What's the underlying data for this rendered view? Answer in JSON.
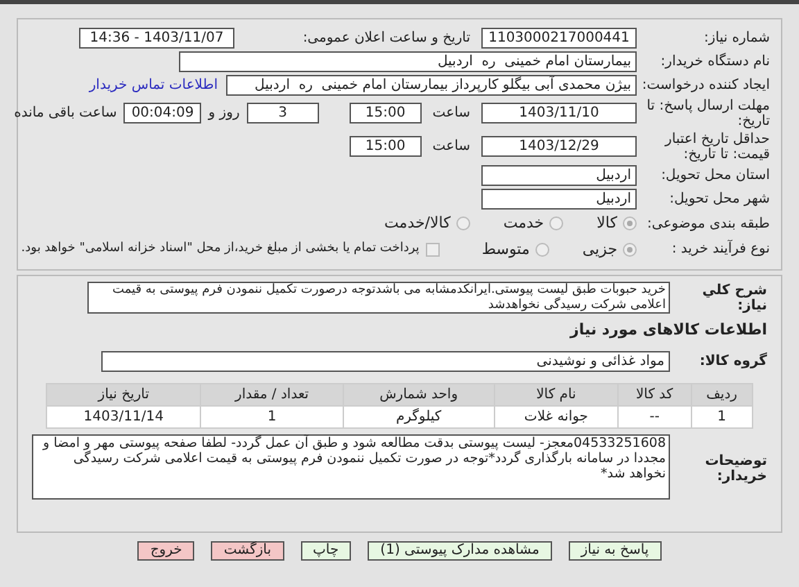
{
  "need_number": {
    "label": "شماره نیاز:",
    "value": "1103000217000441"
  },
  "announce": {
    "label": "تاریخ و ساعت اعلان عمومی:",
    "value": "1403/11/07 - 14:36"
  },
  "buyer": {
    "label": "نام دستگاه خریدار:",
    "value": "بیمارستان امام خمینی  ره  اردبیل"
  },
  "creator": {
    "label": "ایجاد کننده درخواست:",
    "value": "بیژن محمدی آبی بیگلو کارپرداز بیمارستان امام خمینی  ره  اردبیل",
    "link": "اطلاعات تماس خریدار"
  },
  "deadline": {
    "label": "مهلت ارسال پاسخ: تا تاریخ:",
    "date": "1403/11/10",
    "time_label": "ساعت",
    "time": "15:00",
    "days": "3",
    "days_label": "روز و",
    "remaining": "00:04:09",
    "remaining_label": "ساعت باقی مانده"
  },
  "validity": {
    "label": "حداقل تاریخ اعتبار قیمت: تا تاریخ:",
    "date": "1403/12/29",
    "time_label": "ساعت",
    "time": "15:00"
  },
  "province": {
    "label": "استان محل تحویل:",
    "value": "اردبیل"
  },
  "city": {
    "label": "شهر محل تحویل:",
    "value": "اردبیل"
  },
  "category": {
    "label": "طبقه بندی موضوعی:",
    "options": [
      {
        "label": "کالا",
        "selected": true
      },
      {
        "label": "خدمت",
        "selected": false
      },
      {
        "label": "کالا/خدمت",
        "selected": false
      }
    ]
  },
  "process": {
    "label": "نوع فرآیند خرید :",
    "options": [
      {
        "label": "جزیی",
        "selected": true
      },
      {
        "label": "متوسط",
        "selected": false
      }
    ],
    "treasury": {
      "label": "پرداخت تمام یا بخشی از مبلغ خرید،از محل \"اسناد خزانه اسلامی\" خواهد بود.",
      "checked": false
    }
  },
  "summary": {
    "label": "شرح کلي نياز:",
    "value": "خرید حبوبات طبق لیست پیوستی.ایرانکدمشابه می باشدتوجه درصورت تکمیل ننمودن فرم پیوستی به قیمت اعلامی شرکت رسیدگی نخواهدشد"
  },
  "goods_heading": "اطلاعات کالاهای مورد نیاز",
  "goods_group": {
    "label": "گروه کالا:",
    "value": "مواد غذائی و نوشیدنی"
  },
  "table": {
    "columns": [
      "ردیف",
      "کد کالا",
      "نام کالا",
      "واحد شمارش",
      "تعداد / مقدار",
      "تاریخ نیاز"
    ],
    "rows": [
      [
        "1",
        "--",
        "جوانه غلات",
        "کیلوگرم",
        "1",
        "1403/11/14"
      ]
    ]
  },
  "notes": {
    "label": "توضیحات خریدار:",
    "value": "04533251608معجز- لیست پیوستی بدقت مطالعه شود و طبق آن عمل گردد- لطفا صفحه پیوستی مهر و امضا و مجددا در سامانه بارگذاری گردد*توجه در صورت تکمیل ننمودن فرم پیوستی به قیمت اعلامی شرکت رسیدگی نخواهد شد*"
  },
  "buttons": [
    {
      "label": "پاسخ به نیاز",
      "kind": "normal"
    },
    {
      "label": "مشاهده مدارک پیوستی (1)",
      "kind": "normal"
    },
    {
      "label": "چاپ",
      "kind": "normal"
    },
    {
      "label": "بازگشت",
      "kind": "danger"
    },
    {
      "label": "خروج",
      "kind": "danger"
    }
  ]
}
